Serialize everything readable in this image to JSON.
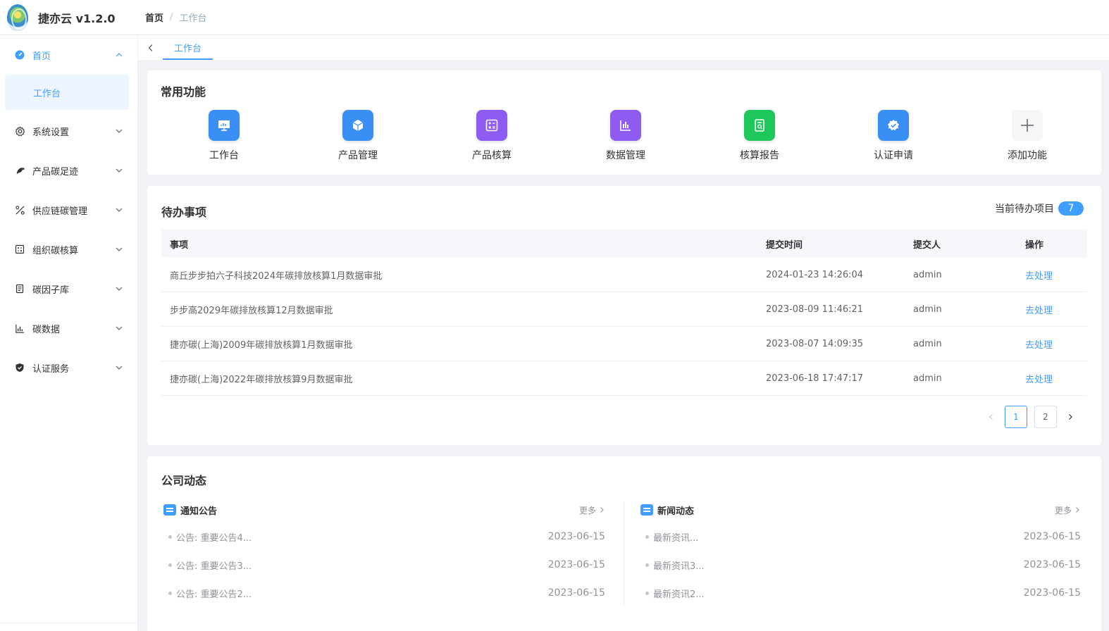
{
  "header": {
    "logo_title": "捷亦云 v1.2.0",
    "breadcrumb": [
      "首页",
      "工作台"
    ]
  },
  "sidebar": {
    "items": [
      {
        "label": "首页",
        "icon": "dashboard-icon",
        "expanded": true,
        "children": [
          {
            "label": "工作台"
          }
        ]
      },
      {
        "label": "系统设置",
        "icon": "gear-icon"
      },
      {
        "label": "产品碳足迹",
        "icon": "footprint-icon"
      },
      {
        "label": "供应链碳管理",
        "icon": "supply-chain-icon"
      },
      {
        "label": "组织碳核算",
        "icon": "calculator-icon"
      },
      {
        "label": "碳因子库",
        "icon": "list-icon"
      },
      {
        "label": "碳数据",
        "icon": "bar-chart-icon"
      },
      {
        "label": "认证服务",
        "icon": "shield-icon"
      }
    ]
  },
  "tabs": [
    {
      "label": "工作台"
    }
  ],
  "functions": {
    "title": "常用功能",
    "items": [
      {
        "label": "工作台",
        "icon": "monitor-icon",
        "color": "#3a8ff5"
      },
      {
        "label": "产品管理",
        "icon": "cube-icon",
        "color": "#3a8ff5"
      },
      {
        "label": "产品核算",
        "icon": "calculator-icon",
        "color": "#8e5cf0"
      },
      {
        "label": "数据管理",
        "icon": "chart-icon",
        "color": "#8e5cf0"
      },
      {
        "label": "核算报告",
        "icon": "report-icon",
        "color": "#1ec65c"
      },
      {
        "label": "认证申请",
        "icon": "badge-check-icon",
        "color": "#3a8ff5"
      },
      {
        "label": "添加功能",
        "icon": "plus-icon",
        "color": "#f5f6f8"
      }
    ]
  },
  "todo": {
    "title": "待办事项",
    "count_label": "当前待办项目",
    "count": "7",
    "columns": [
      "事项",
      "提交时间",
      "提交人",
      "操作"
    ],
    "rows": [
      {
        "item": "商丘步步拍六子科技2024年碳排放核算1月数据审批",
        "time": "2024-01-23 14:26:04",
        "user": "admin",
        "action": "去处理"
      },
      {
        "item": "步步高2029年碳排放核算12月数据审批",
        "time": "2023-08-09 11:46:21",
        "user": "admin",
        "action": "去处理"
      },
      {
        "item": "捷亦碳(上海)2009年碳排放核算1月数据审批",
        "time": "2023-08-07 14:09:35",
        "user": "admin",
        "action": "去处理"
      },
      {
        "item": "捷亦碳(上海)2022年碳排放核算9月数据审批",
        "time": "2023-06-18 17:47:17",
        "user": "admin",
        "action": "去处理"
      }
    ],
    "pagination": {
      "pages": [
        "1",
        "2"
      ],
      "current": "1"
    }
  },
  "news": {
    "title": "公司动态",
    "notices": {
      "title": "通知公告",
      "more": "更多",
      "items": [
        {
          "text": "公告: 重要公告4...",
          "date": "2023-06-15"
        },
        {
          "text": "公告: 重要公告3...",
          "date": "2023-06-15"
        },
        {
          "text": "公告: 重要公告2...",
          "date": "2023-06-15"
        }
      ]
    },
    "updates": {
      "title": "新闻动态",
      "more": "更多",
      "items": [
        {
          "text": "最新资讯...",
          "date": "2023-06-15"
        },
        {
          "text": "最新资讯3...",
          "date": "2023-06-15"
        },
        {
          "text": "最新资讯2...",
          "date": "2023-06-15"
        }
      ]
    }
  }
}
